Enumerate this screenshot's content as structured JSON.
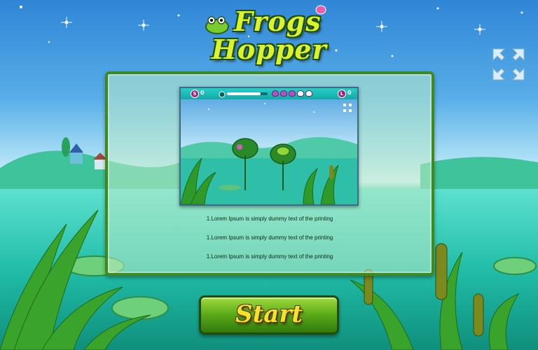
{
  "game": {
    "logo_line1": "Frogs",
    "logo_line2": "Hopper"
  },
  "preview": {
    "score_badge": "S",
    "score_value": "0",
    "lives_badge": "L",
    "lives_value": "0",
    "timer_level": 0.82,
    "flowers": [
      "purple",
      "purple",
      "purple",
      "white",
      "white"
    ]
  },
  "instructions": [
    "1.Lorem Ipsum is simply dummy text of the printing",
    "1.Lorem Ipsum is simply dummy text of the printing",
    "1.Lorem Ipsum is simply dummy text of the printing"
  ],
  "start_button": {
    "label": "Start"
  },
  "colors": {
    "sky": "#58aee8",
    "water": "#2fc7b3",
    "panel_border": "#3f8a1f",
    "logo_text": "#d9f32c",
    "start_text": "#f4e22c",
    "badge": "#a0207e"
  },
  "icons": {
    "fullscreen": "expand-arrows-icon",
    "timer": "stopwatch-icon"
  }
}
